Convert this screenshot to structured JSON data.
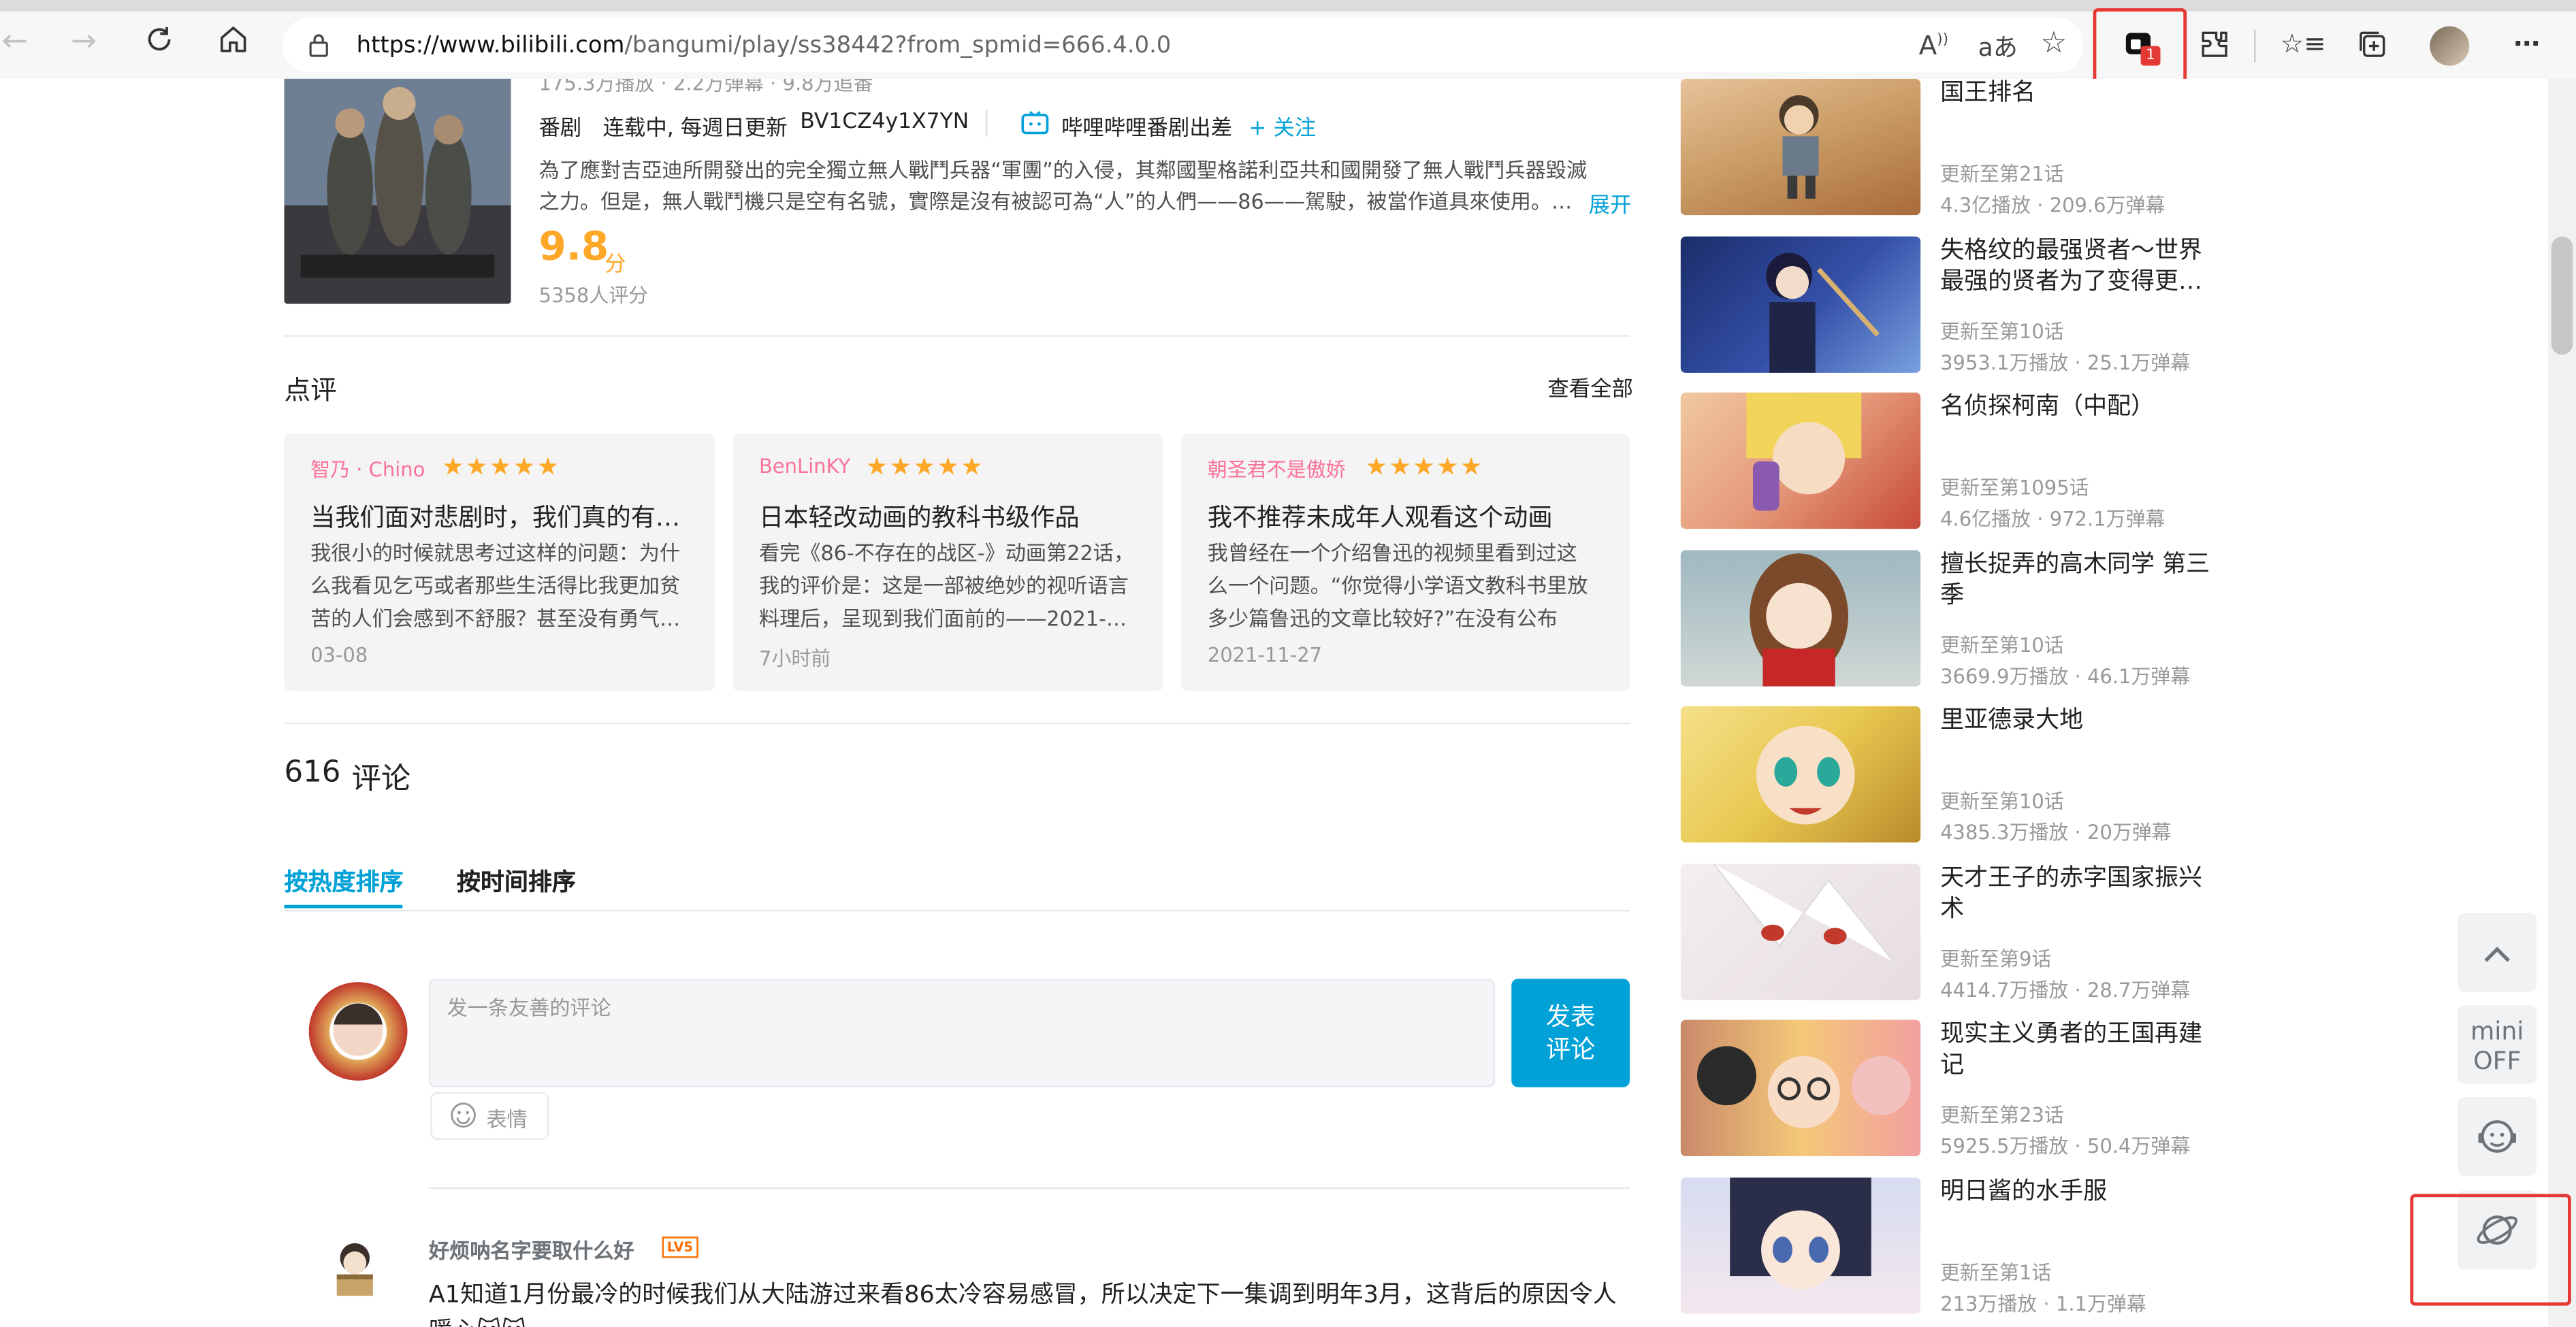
{
  "browser": {
    "url_host": "https://www.bilibili.com",
    "url_path": "/bangumi/play/ss38442?from_spmid=666.4.0.0",
    "extension_badge": "1",
    "icons": [
      "back-icon",
      "forward-icon",
      "refresh-icon",
      "home-icon",
      "lock-icon",
      "read-aloud-icon",
      "translate-icon",
      "favorite-add-icon",
      "extension-active-icon",
      "extensions-icon",
      "favorites-icon",
      "collections-icon",
      "profile-avatar",
      "more-icon"
    ]
  },
  "media": {
    "stats": "175.3万播放 · 2.2万弹幕 · 9.8万追番",
    "type": "番剧",
    "status": "连载中, 每週日更新",
    "bvid": "BV1CZ4y1X7YN",
    "publisher": "哔哩哔哩番剧出差",
    "follow": "+ 关注",
    "description": "為了應對吉亞迪所開發出的完全獨立無人戰鬥兵器“軍團”的入侵，其鄰國聖格諾利亞共和國開發了無人戰鬥兵器毀滅之力。但是，無人戰鬥機只是空有名號，實際是沒有被認可為“人”的人們——86——駕駛，被當作道具來使用。…",
    "expand": "展开",
    "score": "9.8",
    "score_unit": "分",
    "rating_count": "5358人评分"
  },
  "reviews": {
    "section_title": "点评",
    "view_all": "查看全部",
    "items": [
      {
        "user": "智乃 · Chino",
        "stars": 5,
        "title": "当我们面对悲剧时，我们真的有…",
        "body": "我很小的时候就思考过这样的问题：为什么我看见乞丐或者那些生活得比我更加贫苦的人们会感到不舒服？甚至没有勇气…",
        "date": "03-08"
      },
      {
        "user": "BenLinKY",
        "stars": 5,
        "title": "日本轻改动画的教科书级作品",
        "body": "看完《86-不存在的战区-》动画第22话，我的评价是：这是一部被绝妙的视听语言料理后，呈现到我们面前的——2021-…",
        "date": "7小时前"
      },
      {
        "user": "朝圣君不是傲娇",
        "stars": 5,
        "title": "我不推荐未成年人观看这个动画",
        "body": "我曾经在一个介绍鲁迅的视频里看到过这么一个问题。“你觉得小学语文教科书里放多少篇鲁迅的文章比较好?”在没有公布答…",
        "date": "2021-11-27"
      }
    ]
  },
  "comments": {
    "count": "616",
    "label": "评论",
    "sort_hot": "按热度排序",
    "sort_time": "按时间排序",
    "placeholder": "发一条友善的评论",
    "submit": "发表\n评论",
    "emoji": "表情",
    "first": {
      "user": "好烦呐名字要取什么好",
      "level": "LV5",
      "text": "A1知道1月份最冷的时候我们从大陆游过来看86太冷容易感冒，所以决定下一集调到明年3月，这背后的原因令人暖心🐱🐱"
    }
  },
  "sidebar": {
    "items": [
      {
        "title": "国王排名",
        "update": "更新至第21话",
        "plays": "4.3亿播放",
        "danmaku": "209.6万弹幕"
      },
      {
        "title": "失格纹的最强贤者～世界最强的贤者为了变得更…",
        "update": "更新至第10话",
        "plays": "3953.1万播放",
        "danmaku": "25.1万弹幕"
      },
      {
        "title": "名侦探柯南（中配）",
        "update": "更新至第1095话",
        "plays": "4.6亿播放",
        "danmaku": "972.1万弹幕"
      },
      {
        "title": "擅长捉弄的高木同学 第三季",
        "update": "更新至第10话",
        "plays": "3669.9万播放",
        "danmaku": "46.1万弹幕"
      },
      {
        "title": "里亚德录大地",
        "update": "更新至第10话",
        "plays": "4385.3万播放",
        "danmaku": "20万弹幕"
      },
      {
        "title": "天才王子的赤字国家振兴术",
        "update": "更新至第9话",
        "plays": "4414.7万播放",
        "danmaku": "28.7万弹幕"
      },
      {
        "title": "现实主义勇者的王国再建记",
        "update": "更新至第23话",
        "plays": "5925.5万播放",
        "danmaku": "50.4万弹幕"
      },
      {
        "title": "明日酱的水手服",
        "update": "更新至第1话",
        "plays": "213万播放",
        "danmaku": "1.1万弹幕"
      }
    ]
  },
  "floating": {
    "mini_line1": "mini",
    "mini_line2": "OFF"
  },
  "colors": {
    "accent": "#00a1d6",
    "pink": "#fb7299",
    "score": "#ffa726",
    "highlight_box": "#e53935"
  }
}
